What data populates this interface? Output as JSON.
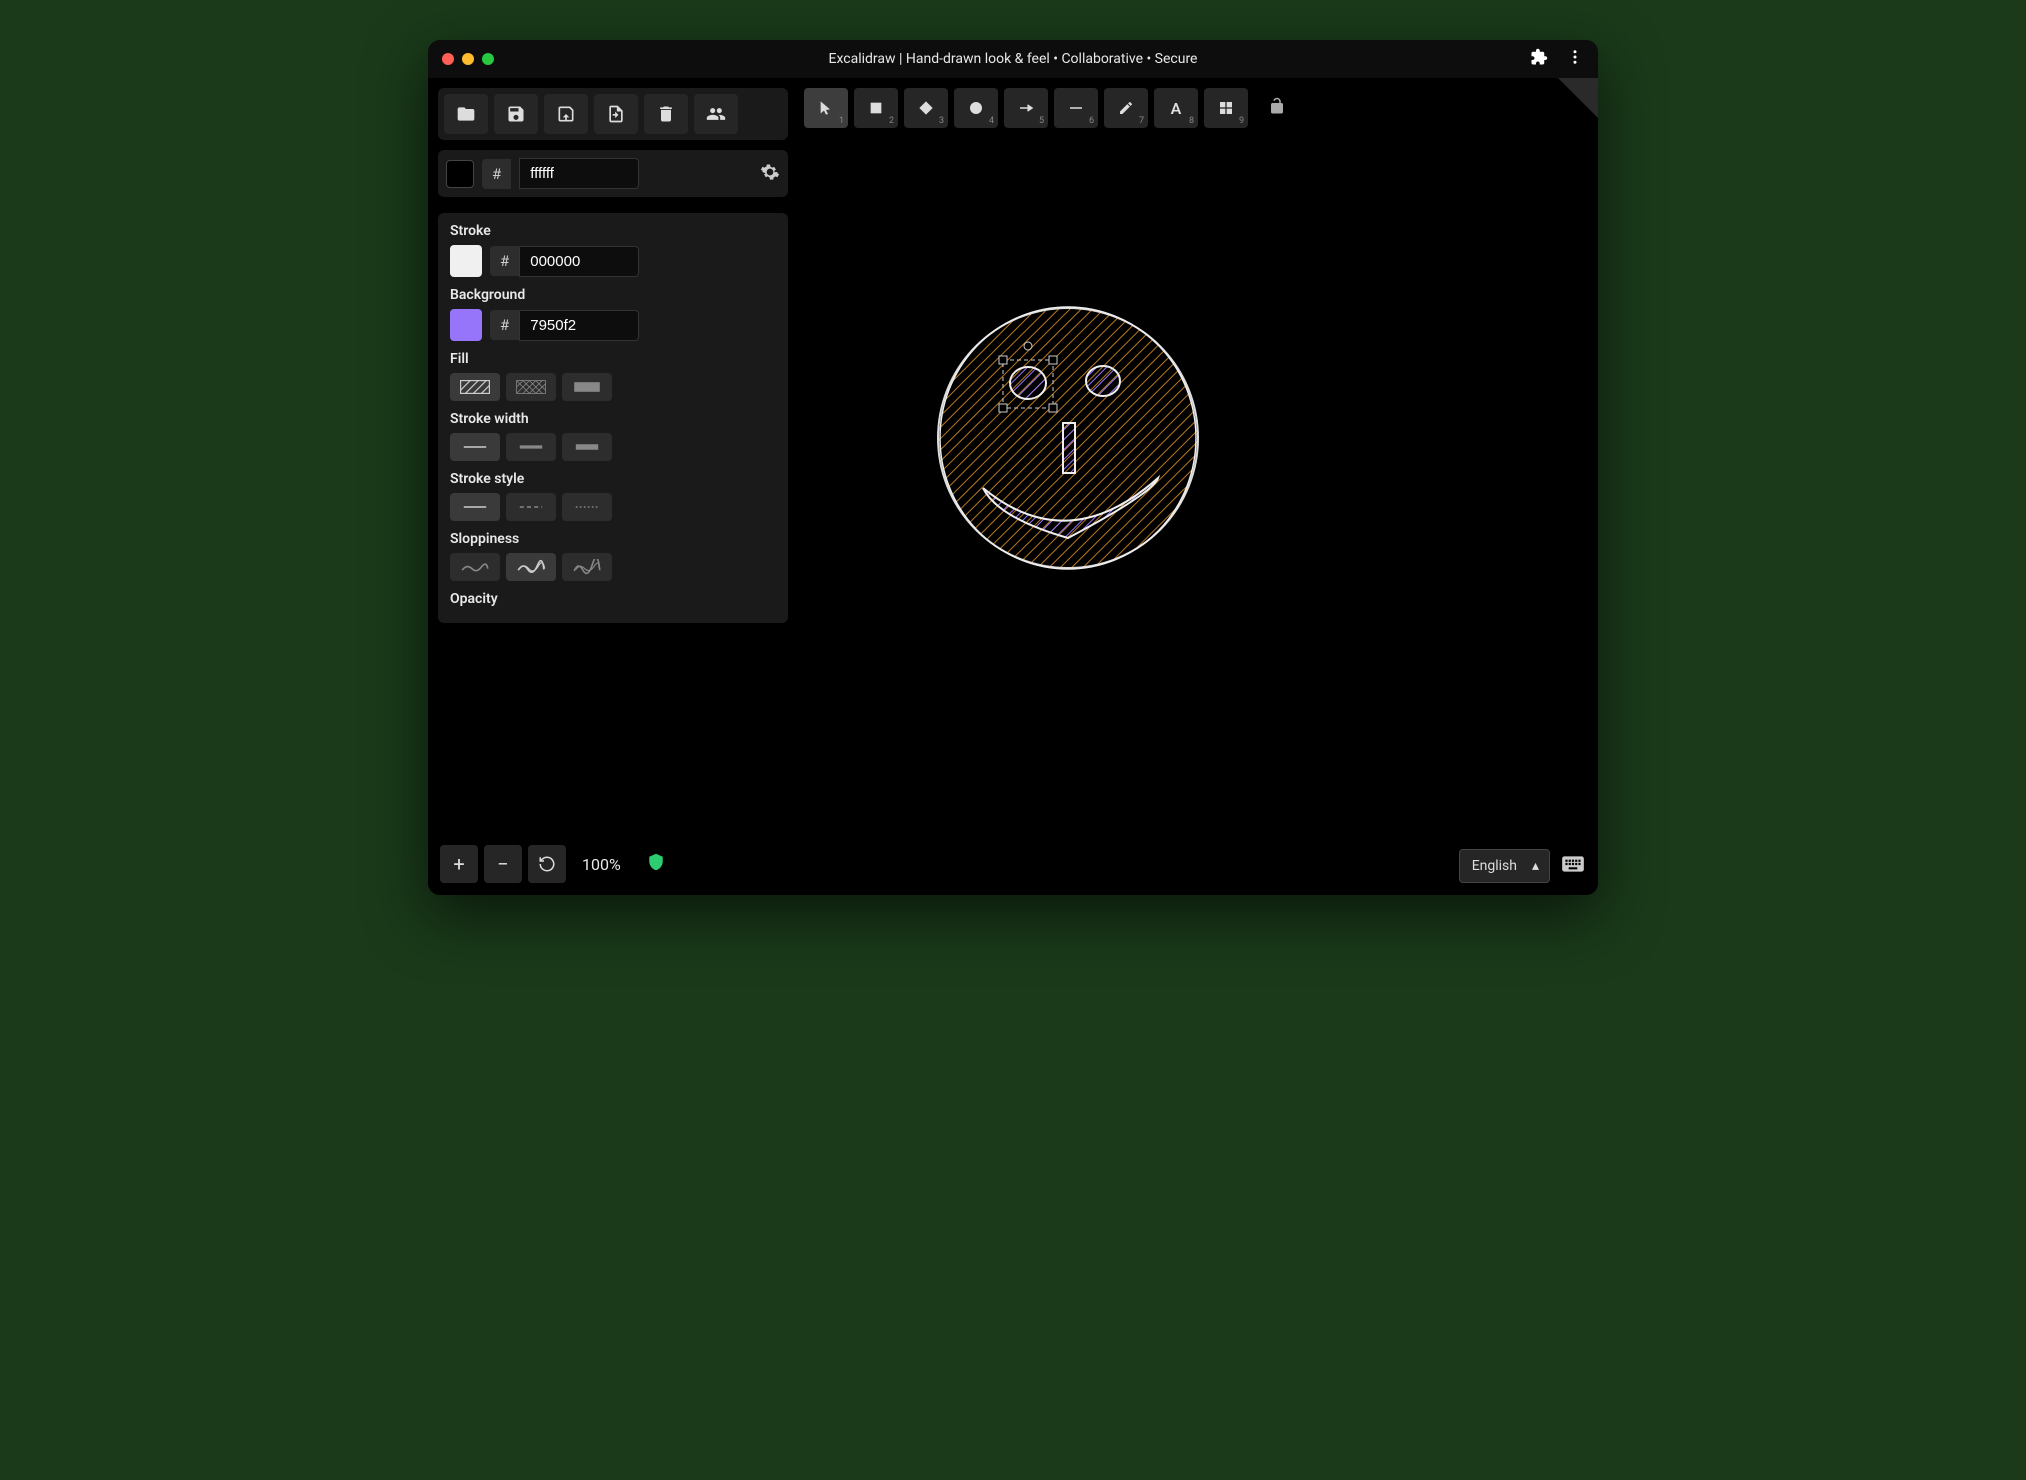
{
  "window": {
    "title": "Excalidraw | Hand-drawn look & feel • Collaborative • Secure"
  },
  "canvas_color": {
    "hash": "#",
    "value": "ffffff",
    "swatch": "#000000"
  },
  "properties": {
    "stroke": {
      "label": "Stroke",
      "hash": "#",
      "value": "000000",
      "swatch": "#f0f0f0"
    },
    "background": {
      "label": "Background",
      "hash": "#",
      "value": "7950f2",
      "swatch": "#9775fa"
    },
    "fill_label": "Fill",
    "stroke_width_label": "Stroke width",
    "stroke_style_label": "Stroke style",
    "sloppiness_label": "Sloppiness",
    "opacity_label": "Opacity"
  },
  "shape_tools": [
    {
      "name": "select",
      "num": "1"
    },
    {
      "name": "rectangle",
      "num": "2"
    },
    {
      "name": "diamond",
      "num": "3"
    },
    {
      "name": "circle",
      "num": "4"
    },
    {
      "name": "arrow",
      "num": "5"
    },
    {
      "name": "line",
      "num": "6"
    },
    {
      "name": "draw",
      "num": "7"
    },
    {
      "name": "text",
      "num": "8"
    },
    {
      "name": "library",
      "num": "9"
    }
  ],
  "zoom": {
    "value": "100%"
  },
  "language": {
    "selected": "English"
  }
}
